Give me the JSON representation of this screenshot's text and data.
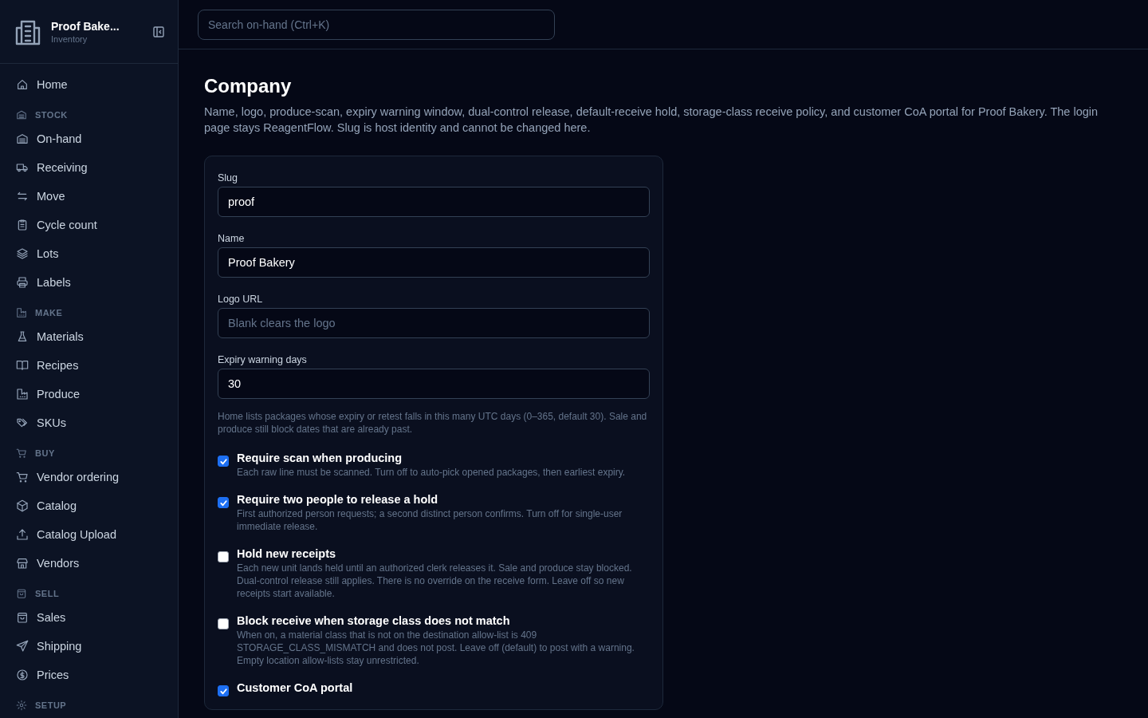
{
  "brand": {
    "name": "Proof Bake...",
    "subtitle": "Inventory"
  },
  "sidebar": {
    "top_items": [
      {
        "label": "Home",
        "selected": false
      }
    ],
    "sections": [
      {
        "title": "STOCK",
        "items": [
          {
            "label": "On-hand",
            "selected": false
          },
          {
            "label": "Receiving",
            "selected": false
          },
          {
            "label": "Move",
            "selected": false
          },
          {
            "label": "Cycle count",
            "selected": false
          },
          {
            "label": "Lots",
            "selected": false
          },
          {
            "label": "Labels",
            "selected": false
          }
        ]
      },
      {
        "title": "MAKE",
        "items": [
          {
            "label": "Materials",
            "selected": false
          },
          {
            "label": "Recipes",
            "selected": false
          },
          {
            "label": "Produce",
            "selected": false
          },
          {
            "label": "SKUs",
            "selected": false
          }
        ]
      },
      {
        "title": "BUY",
        "items": [
          {
            "label": "Vendor ordering",
            "selected": false
          },
          {
            "label": "Catalog",
            "selected": false
          },
          {
            "label": "Catalog Upload",
            "selected": false
          },
          {
            "label": "Vendors",
            "selected": false
          }
        ]
      },
      {
        "title": "SELL",
        "items": [
          {
            "label": "Sales",
            "selected": false
          },
          {
            "label": "Shipping",
            "selected": false
          },
          {
            "label": "Prices",
            "selected": false
          }
        ]
      },
      {
        "title": "SETUP"
      }
    ]
  },
  "search": {
    "placeholder": "Search on-hand (Ctrl+K)"
  },
  "page": {
    "title": "Company",
    "description": "Name, logo, produce-scan, expiry warning window, dual-control release, default-receive hold, storage-class receive policy, and customer CoA portal for Proof Bakery. The login page stays ReagentFlow. Slug is host identity and cannot be changed here."
  },
  "fields": [
    {
      "label": "Slug",
      "value": "proof"
    },
    {
      "label": "Name",
      "value": "Proof Bakery"
    },
    {
      "label": "Logo URL",
      "placeholder": "Blank clears the logo"
    },
    {
      "label": "Expiry warning days",
      "value": "30",
      "help": "Home lists packages whose expiry or retest falls in this many UTC days (0–365, default 30). Sale and produce still block dates that are already past."
    }
  ],
  "options": [
    {
      "label": "Require scan when producing",
      "checked": true,
      "description": "Each raw line must be scanned. Turn off to auto-pick opened packages, then earliest expiry."
    },
    {
      "label": "Require two people to release a hold",
      "checked": true,
      "description": "First authorized person requests; a second distinct person confirms. Turn off for single-user immediate release."
    },
    {
      "label": "Hold new receipts",
      "checked": false,
      "description": "Each new unit lands held until an authorized clerk releases it. Sale and produce stay blocked. Dual-control release still applies. There is no override on the receive form. Leave off so new receipts start available."
    },
    {
      "label": "Block receive when storage class does not match",
      "checked": false,
      "description": "When on, a material class that is not on the destination allow-list is 409 STORAGE_CLASS_MISMATCH and does not post. Leave off (default) to post with a warning. Empty location allow-lists stay unrestricted."
    },
    {
      "label": "Customer CoA portal",
      "checked": true
    }
  ]
}
